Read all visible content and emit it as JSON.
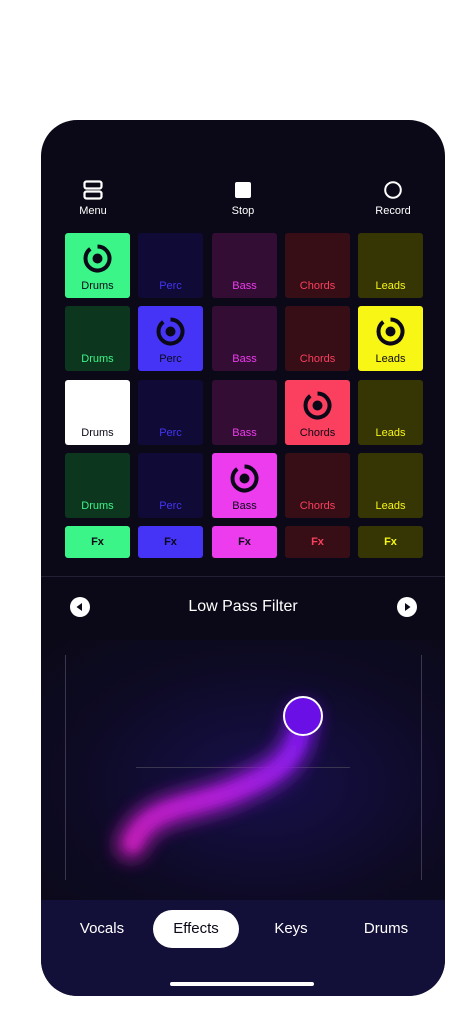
{
  "toolbar": {
    "menu_label": "Menu",
    "stop_label": "Stop",
    "record_label": "Record"
  },
  "colors": {
    "drums": "#3cf588",
    "perc": "#4534f6",
    "bass": "#ec3cee",
    "chords": "#fb3f5f",
    "leads": "#f7f615",
    "background": "#0b0917",
    "tab_bar": "#121039"
  },
  "pads": {
    "columns": [
      "Drums",
      "Perc",
      "Bass",
      "Chords",
      "Leads"
    ],
    "rows": [
      [
        "active",
        "idle",
        "idle",
        "idle",
        "idle"
      ],
      [
        "idle",
        "active",
        "idle",
        "idle",
        "active"
      ],
      [
        "selected",
        "idle",
        "idle",
        "active",
        "idle"
      ],
      [
        "idle",
        "idle",
        "active",
        "idle",
        "idle"
      ]
    ],
    "fx_label": "Fx",
    "fx_states": [
      "active",
      "active",
      "active",
      "idle",
      "idle"
    ]
  },
  "effect": {
    "title": "Low Pass Filter",
    "prev_icon": "play-left-icon",
    "next_icon": "play-right-icon"
  },
  "tabs": [
    {
      "label": "Vocals",
      "active": false
    },
    {
      "label": "Effects",
      "active": true
    },
    {
      "label": "Keys",
      "active": false
    },
    {
      "label": "Drums",
      "active": false
    }
  ]
}
